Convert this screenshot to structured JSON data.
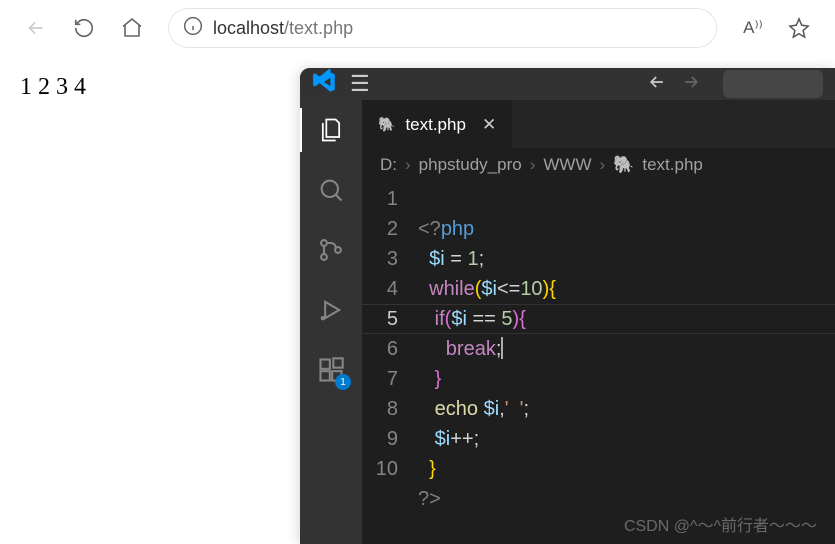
{
  "browser": {
    "url_host": "localhost",
    "url_path": "/text.php",
    "read_aloud_label": "A⁾⁾",
    "page_output": "1 2 3 4"
  },
  "vscode": {
    "tab": {
      "filename": "text.php"
    },
    "breadcrumbs": {
      "drive": "D:",
      "folder1": "phpstudy_pro",
      "folder2": "WWW",
      "file": "text.php"
    },
    "activity_badge": "1",
    "gutter": [
      "1",
      "2",
      "3",
      "4",
      "5",
      "6",
      "7",
      "8",
      "9",
      "10"
    ],
    "code": {
      "l1_open": "<?",
      "l1_php": "php",
      "l2_var": "$i",
      "l2_eq": " = ",
      "l2_num": "1",
      "l2_semi": ";",
      "l3_while": "while",
      "l3_op": "(",
      "l3_var": "$i",
      "l3_cmp": "<=",
      "l3_num": "10",
      "l3_cp": ")",
      "l3_ob": "{",
      "l4_if": "if",
      "l4_op": "(",
      "l4_var": "$i",
      "l4_eq": " == ",
      "l4_num": "5",
      "l4_cp": ")",
      "l4_ob": "{",
      "l5_break": "break",
      "l5_semi": ";",
      "l6_cb": "}",
      "l7_echo": "echo",
      "l7_sp": " ",
      "l7_var": "$i",
      "l7_comma": ",",
      "l7_str": "'  '",
      "l7_semi": ";",
      "l8_var": "$i",
      "l8_inc": "++;",
      "l9_cb": "}",
      "l10_close": "?>"
    },
    "watermark": "CSDN @^～^前行者～～～"
  }
}
